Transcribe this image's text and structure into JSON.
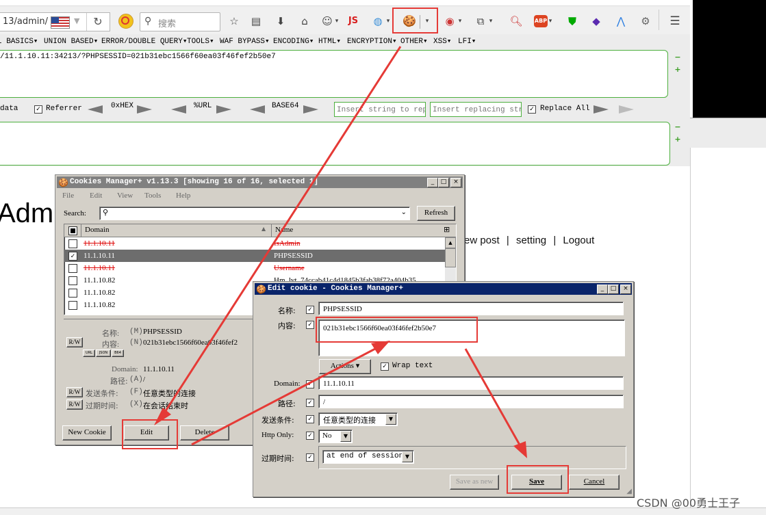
{
  "browser": {
    "url_partial": "13/admin/",
    "search_placeholder": "搜索",
    "js_icon_label": "JS",
    "abp_label": "ABP"
  },
  "hackbar": {
    "menu": [
      "L BASICS▾",
      "UNION BASED▾",
      "ERROR/DOUBLE QUERY▾",
      "TOOLS▾",
      "WAF BYPASS▾",
      "ENCODING▾",
      "HTML▾",
      "ENCRYPTION▾",
      "OTHER▾",
      "XSS▾",
      "LFI▾"
    ],
    "url_value": "/11.1.10.11:34213/?PHPSESSID=021b31ebc1566f60ea03f46fef2b50e7",
    "post_data_label": "data",
    "referrer_label": "Referrer",
    "encoders": [
      "0xHEX",
      "%URL",
      "BASE64"
    ],
    "insert_string_placeholder": "Insert string to repla",
    "insert_replacing_placeholder": "Insert replacing strin",
    "replace_all_label": "Replace All"
  },
  "page": {
    "heading_fragment": "Admi",
    "links": [
      "ew post",
      "setting",
      "Logout"
    ],
    "separator": "|"
  },
  "cookies_manager": {
    "title": "Cookies Manager+ v1.13.3 [showing 16 of 16, selected 1]",
    "menu": [
      "File",
      "Edit",
      "View",
      "Tools",
      "Help"
    ],
    "search_label": "Search:",
    "refresh_label": "Refresh",
    "columns": [
      "Domain",
      "Name"
    ],
    "rows": [
      {
        "domain": "11.1.10.11",
        "name": "IsAdmin",
        "struck": true,
        "checked": false
      },
      {
        "domain": "11.1.10.11",
        "name": "PHPSESSID",
        "struck": false,
        "checked": true,
        "selected": true
      },
      {
        "domain": "11.1.10.11",
        "name": "Username",
        "struck": true,
        "checked": false
      },
      {
        "domain": "11.1.10.82",
        "name": "Hm_lvt_74ccab41c4d1845b3fab38f72a404b35",
        "struck": false,
        "checked": false
      },
      {
        "domain": "11.1.10.82",
        "name": "",
        "struck": false,
        "checked": false
      },
      {
        "domain": "11.1.10.82",
        "name": "",
        "struck": false,
        "checked": false
      }
    ],
    "details": {
      "name_label": "名称:",
      "name_key": "(M)",
      "name_value": "PHPSESSID",
      "content_label": "内容:",
      "content_key": "(N)",
      "content_value": "021b31ebc1566f60ea03f46fef2",
      "rw": "R/W",
      "mini_btns": [
        "URL",
        "JSON",
        "B64"
      ],
      "domain_label": "Domain:",
      "domain_value": "11.1.10.11",
      "path_label": "路径:",
      "path_key": "(A)",
      "path_value": "/",
      "send_label": "发送条件:",
      "send_key": "(F)",
      "send_value": "任意类型的连接",
      "expires_label": "过期时间:",
      "expires_key": "(X)",
      "expires_value": "在会话结束时"
    },
    "buttons": {
      "new": "New Cookie",
      "edit": "Edit",
      "delete": "Delete"
    }
  },
  "edit_cookie": {
    "title": "Edit cookie - Cookies Manager+",
    "name_label": "名称:",
    "name_value": "PHPSESSID",
    "content_label": "内容:",
    "content_value": "021b31ebc1566f60ea03f46fef2b50e7",
    "actions_label": "Actions",
    "wrap_text_label": "Wrap text",
    "domain_label": "Domain:",
    "domain_value": "11.1.10.11",
    "path_label": "路径:",
    "path_value": "/",
    "send_label": "发送条件:",
    "send_value": "任意类型的连接",
    "httponly_label": "Http Only:",
    "httponly_value": "No",
    "expires_label": "过期时间:",
    "expires_value": "at end of session",
    "save_as_new_label": "Save as new",
    "save_label": "Save",
    "cancel_label": "Cancel"
  },
  "watermark": "CSDN @00勇士王子",
  "colors": {
    "annotation_red": "#e53a36",
    "hackbar_green": "#4caf3d",
    "title_active": "#0a246a"
  }
}
